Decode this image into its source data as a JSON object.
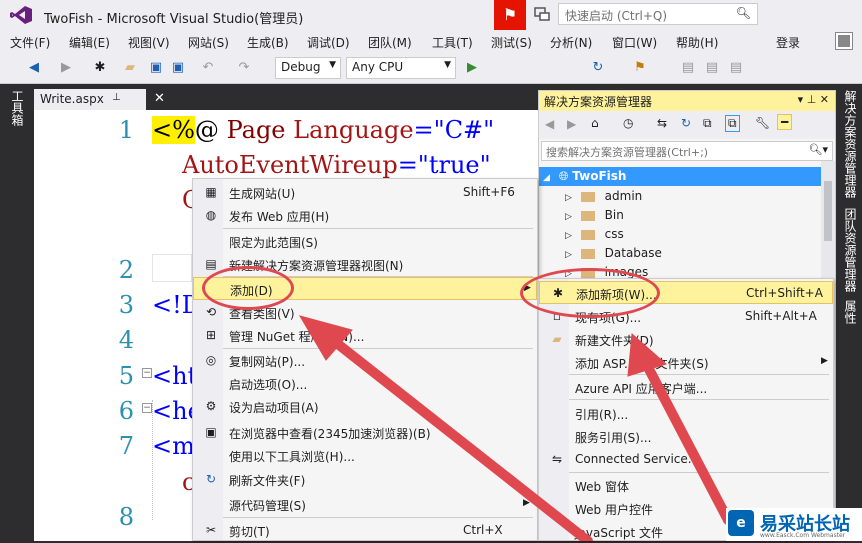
{
  "window": {
    "title": "TwoFish - Microsoft Visual Studio(管理员)",
    "quick_launch_placeholder": "快速启动 (Ctrl+Q)",
    "login": "登录"
  },
  "menubar": [
    "文件(F)",
    "编辑(E)",
    "视图(V)",
    "网站(S)",
    "生成(B)",
    "调试(D)",
    "团队(M)",
    "工具(T)",
    "测试(S)",
    "分析(N)",
    "窗口(W)",
    "帮助(H)"
  ],
  "toolbar": {
    "config": "Debug",
    "platform": "Any CPU"
  },
  "left_strip": {
    "toolbox": "工具箱"
  },
  "right_strip": {
    "solution_explorer": "解决方案资源管理器",
    "team_explorer": "团队资源管理器",
    "properties": "属性"
  },
  "editor": {
    "tab": "Write.aspx",
    "lines": [
      {
        "num": "1",
        "text": "<%@ Page Language=\"C#\""
      },
      {
        "num": "",
        "text": "AutoEventWireup=\"true\""
      },
      {
        "num": "",
        "text": "C"
      },
      {
        "num": "2",
        "text": ""
      },
      {
        "num": "3",
        "text": "<!D"
      },
      {
        "num": "4",
        "text": ""
      },
      {
        "num": "5",
        "text": "<ht"
      },
      {
        "num": "6",
        "text": "<he"
      },
      {
        "num": "7",
        "text": "<me"
      },
      {
        "num": "",
        "text": "c"
      },
      {
        "num": "8",
        "text": ""
      }
    ]
  },
  "solution_explorer": {
    "title": "解决方案资源管理器",
    "search_placeholder": "搜索解决方案资源管理器(Ctrl+;)",
    "root": "TwoFish",
    "items": [
      "admin",
      "Bin",
      "css",
      "Database",
      "images"
    ]
  },
  "context_menu": {
    "items": [
      {
        "label": "生成网站(U)",
        "shortcut": "Shift+F6",
        "icon": "build-icon"
      },
      {
        "label": "发布 Web 应用(H)",
        "shortcut": "",
        "icon": "globe-icon"
      },
      {
        "label": "限定为此范围(S)",
        "shortcut": "",
        "icon": ""
      },
      {
        "label": "新建解决方案资源管理器视图(N)",
        "shortcut": "",
        "icon": "new-view-icon"
      },
      {
        "label": "添加(D)",
        "shortcut": "",
        "icon": "",
        "submenu": true
      },
      {
        "label": "查看类图(V)",
        "shortcut": "",
        "icon": "class-diagram-icon"
      },
      {
        "label": "管理 NuGet 程序包(N)...",
        "shortcut": "",
        "icon": "nuget-icon"
      },
      {
        "label": "复制网站(P)...",
        "shortcut": "",
        "icon": "copy-website-icon"
      },
      {
        "label": "启动选项(O)...",
        "shortcut": "",
        "icon": ""
      },
      {
        "label": "设为启动项目(A)",
        "shortcut": "",
        "icon": "gear-icon"
      },
      {
        "label": "在浏览器中查看(2345加速浏览器)(B)",
        "shortcut": "",
        "icon": "browser-icon"
      },
      {
        "label": "使用以下工具浏览(H)...",
        "shortcut": "",
        "icon": ""
      },
      {
        "label": "刷新文件夹(F)",
        "shortcut": "",
        "icon": "refresh-icon"
      },
      {
        "label": "源代码管理(S)",
        "shortcut": "",
        "icon": "",
        "submenu": true
      },
      {
        "label": "剪切(T)",
        "shortcut": "Ctrl+X",
        "icon": "cut-icon"
      }
    ]
  },
  "submenu": {
    "items": [
      {
        "label": "添加新项(W)...",
        "shortcut": "Ctrl+Shift+A",
        "icon": "new-item-icon"
      },
      {
        "label": "现有项(G)...",
        "shortcut": "Shift+Alt+A",
        "icon": "existing-item-icon"
      },
      {
        "label": "新建文件夹(D)",
        "shortcut": "",
        "icon": "new-folder-icon"
      },
      {
        "label": "添加 ASP.NET 文件夹(S)",
        "shortcut": "",
        "icon": "",
        "submenu": true
      },
      {
        "label": "Azure API 应用客户端...",
        "shortcut": "",
        "icon": ""
      },
      {
        "label": "引用(R)...",
        "shortcut": "",
        "icon": ""
      },
      {
        "label": "服务引用(S)...",
        "shortcut": "",
        "icon": ""
      },
      {
        "label": "Connected Service...",
        "shortcut": "",
        "icon": "connected-service-icon"
      },
      {
        "label": "Web 窗体",
        "shortcut": "",
        "icon": ""
      },
      {
        "label": "Web 用户控件",
        "shortcut": "",
        "icon": ""
      },
      {
        "label": "JavaScript 文件",
        "shortcut": "",
        "icon": ""
      }
    ]
  },
  "watermark": {
    "logo": "e",
    "text": "易采站长站",
    "sub": "www.Easck.Com Webmaster"
  }
}
